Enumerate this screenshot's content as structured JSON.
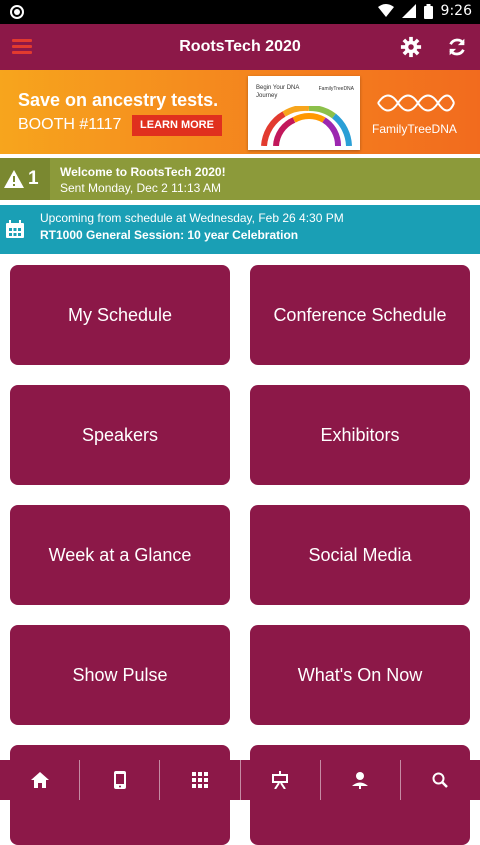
{
  "status_bar": {
    "time": "9:26"
  },
  "app_bar": {
    "title": "RootsTech 2020"
  },
  "banner": {
    "headline": "Save on ancestry tests.",
    "booth": "BOOTH #1117",
    "cta": "LEARN MORE",
    "kit_text": "Begin Your DNA Journey",
    "kit_logo": "FamilyTreeDNA",
    "brand": "FamilyTreeDNA"
  },
  "notice": {
    "count": "1",
    "title": "Welcome to RootsTech 2020!",
    "subtitle": "Sent Monday, Dec 2 11:13 AM"
  },
  "upcoming": {
    "line1": "Upcoming from schedule at Wednesday, Feb 26 4:30 PM",
    "line2": "RT1000 General Session: 10 year Celebration"
  },
  "tiles": [
    {
      "label": "My Schedule"
    },
    {
      "label": "Conference Schedule"
    },
    {
      "label": "Speakers"
    },
    {
      "label": "Exhibitors"
    },
    {
      "label": "Week at a Glance"
    },
    {
      "label": "Social Media"
    },
    {
      "label": "Show Pulse"
    },
    {
      "label": "What's On Now"
    },
    {
      "label": ""
    },
    {
      "label": ""
    }
  ],
  "tabs": [
    {
      "icon": "home-icon"
    },
    {
      "icon": "phone-icon"
    },
    {
      "icon": "grid-icon"
    },
    {
      "icon": "presentation-icon"
    },
    {
      "icon": "person-icon"
    },
    {
      "icon": "search-icon"
    }
  ],
  "colors": {
    "primary": "#8c1848",
    "notice": "#8c9a3a",
    "upcoming": "#1a9fb5",
    "banner": "#f58c1e"
  }
}
